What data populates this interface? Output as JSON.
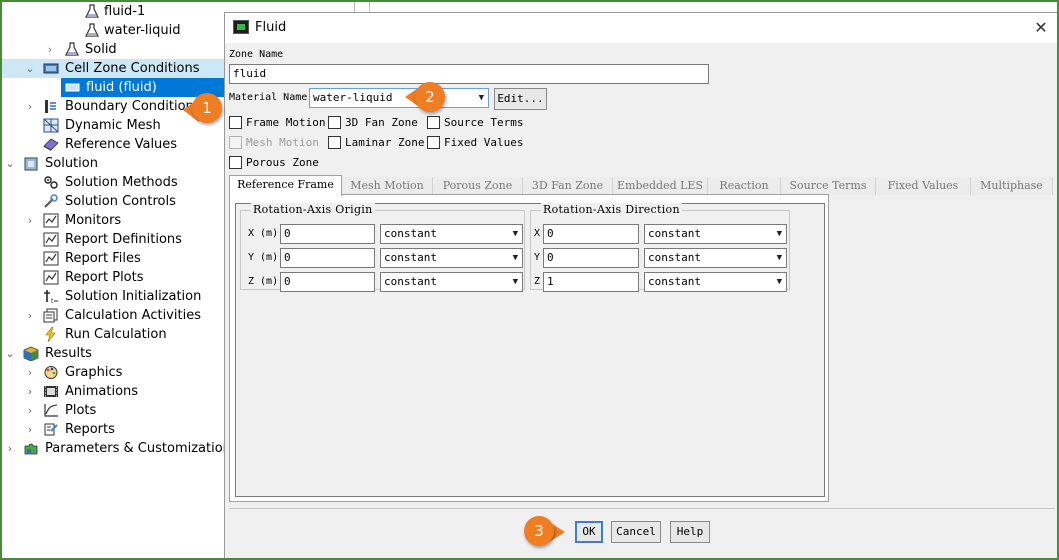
{
  "tree": {
    "items": [
      {
        "label": "fluid-1",
        "icon": "flask-icon"
      },
      {
        "label": "water-liquid",
        "icon": "flask-icon"
      },
      {
        "label": "Solid",
        "icon": "flask-icon"
      },
      {
        "label": "Cell Zone Conditions",
        "icon": "cell-zone-icon"
      },
      {
        "label": "fluid (fluid)",
        "icon": "zone-icon"
      },
      {
        "label": "Boundary Conditions",
        "icon": "boundary-icon"
      },
      {
        "label": "Dynamic Mesh",
        "icon": "mesh-icon"
      },
      {
        "label": "Reference Values",
        "icon": "reference-icon"
      },
      {
        "label": "Solution",
        "icon": "solution-icon"
      },
      {
        "label": "Solution Methods",
        "icon": "methods-icon"
      },
      {
        "label": "Solution Controls",
        "icon": "controls-icon"
      },
      {
        "label": "Monitors",
        "icon": "monitor-icon"
      },
      {
        "label": "Report Definitions",
        "icon": "report-icon"
      },
      {
        "label": "Report Files",
        "icon": "report-icon"
      },
      {
        "label": "Report Plots",
        "icon": "report-icon"
      },
      {
        "label": "Solution Initialization",
        "icon": "init-icon"
      },
      {
        "label": "Calculation Activities",
        "icon": "activities-icon"
      },
      {
        "label": "Run Calculation",
        "icon": "lightning-icon"
      },
      {
        "label": "Results",
        "icon": "results-icon"
      },
      {
        "label": "Graphics",
        "icon": "graphics-icon"
      },
      {
        "label": "Animations",
        "icon": "film-icon"
      },
      {
        "label": "Plots",
        "icon": "plot-icon"
      },
      {
        "label": "Reports",
        "icon": "reports-icon"
      },
      {
        "label": "Parameters & Customization",
        "icon": "puzzle-icon"
      }
    ]
  },
  "dialog": {
    "title": "Fluid",
    "close_glyph": "✕",
    "zone_name_label": "Zone Name",
    "zone_name_value": "fluid",
    "material_name_label": "Material Name",
    "material_name_value": "water-liquid",
    "edit_label": "Edit...",
    "checkboxes": {
      "frame_motion": "Frame Motion",
      "fan_zone": "3D Fan Zone",
      "source_terms": "Source Terms",
      "mesh_motion": "Mesh Motion",
      "laminar_zone": "Laminar Zone",
      "fixed_values": "Fixed Values",
      "porous_zone": "Porous Zone"
    },
    "tabs": [
      "Reference Frame",
      "Mesh Motion",
      "Porous Zone",
      "3D Fan Zone",
      "Embedded LES",
      "Reaction",
      "Source Terms",
      "Fixed Values",
      "Multiphase"
    ],
    "origin": {
      "title": "Rotation-Axis Origin",
      "rows": [
        {
          "label": "X (m)",
          "value": "0",
          "method": "constant"
        },
        {
          "label": "Y (m)",
          "value": "0",
          "method": "constant"
        },
        {
          "label": "Z (m)",
          "value": "0",
          "method": "constant"
        }
      ]
    },
    "direction": {
      "title": "Rotation-Axis Direction",
      "rows": [
        {
          "label": "X",
          "value": "0",
          "method": "constant"
        },
        {
          "label": "Y",
          "value": "0",
          "method": "constant"
        },
        {
          "label": "Z",
          "value": "1",
          "method": "constant"
        }
      ]
    },
    "buttons": {
      "ok": "OK",
      "cancel": "Cancel",
      "help": "Help"
    }
  },
  "annotations": [
    "1",
    "2",
    "3"
  ],
  "colors": {
    "selection": "#0078d7",
    "hover": "#cce8f6",
    "badge": "#ef7d22",
    "frame": "#4a8a3a"
  }
}
